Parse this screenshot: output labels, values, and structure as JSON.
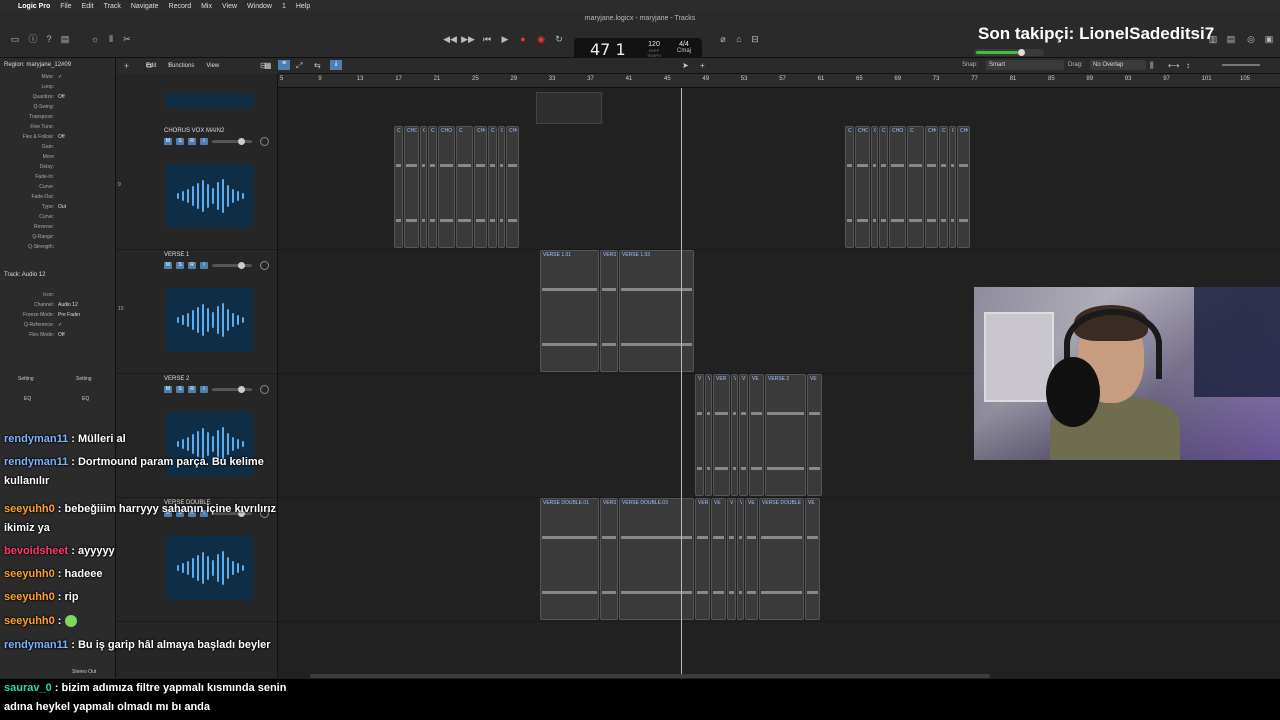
{
  "menubar": {
    "app": "Logic Pro",
    "items": [
      "File",
      "Edit",
      "Track",
      "Navigate",
      "Record",
      "Mix",
      "View",
      "Window",
      "1",
      "Help"
    ]
  },
  "window_title": "maryjane.logicx - maryjane - Tracks",
  "lcd": {
    "position": "47  1",
    "tempo": "120",
    "tempo_label": "KEEP",
    "tempo_sub": "TEMPO",
    "time_sig": "4/4",
    "key": "Cmaj",
    "key_label": "6/4"
  },
  "overlay": {
    "follower": "Son takipçi: LionelSadeditsi7"
  },
  "colors": {
    "accent": "#4f7fb0",
    "region_name": "#9ec5ff",
    "volume_green": "#3fc03f"
  },
  "toolbar": {
    "edit": "Edit",
    "functions": "Functions",
    "view": "View",
    "snap_label": "Snap:",
    "snap_value": "Smart",
    "drag_label": "Drag:",
    "drag_value": "No Overlap",
    "s_button": "S"
  },
  "inspector": {
    "region_header": "Region:  maryjane_12#09",
    "rows": [
      {
        "label": "Mute:",
        "value": "✓"
      },
      {
        "label": "Loop:",
        "value": ""
      },
      {
        "label": "Quantize:",
        "value": "Off"
      },
      {
        "label": "Q-Swing:",
        "value": ""
      },
      {
        "label": "Transpose:",
        "value": ""
      },
      {
        "label": "Fine Tune:",
        "value": ""
      },
      {
        "label": "Flex & Follow:",
        "value": "Off"
      },
      {
        "label": "Gain:",
        "value": ""
      },
      {
        "label": "More",
        "value": ""
      },
      {
        "label": "Delay:",
        "value": ""
      },
      {
        "label": "Fade-In:",
        "value": ""
      },
      {
        "label": "Curve:",
        "value": ""
      },
      {
        "label": "Fade-Out:",
        "value": ""
      },
      {
        "label": "Type:",
        "value": "Out"
      },
      {
        "label": "Curve:",
        "value": ""
      },
      {
        "label": "Reverse:",
        "value": ""
      },
      {
        "label": "Q-Range:",
        "value": ""
      },
      {
        "label": "Q-Strength:",
        "value": ""
      }
    ],
    "track_header": "Track:  Audio 12",
    "track_rows": [
      {
        "label": "Icon:",
        "value": ""
      },
      {
        "label": "Channel:",
        "value": "Audio 12"
      },
      {
        "label": "Freeze Mode:",
        "value": "Pre Fader"
      },
      {
        "label": "Q-Reference:",
        "value": "✓"
      },
      {
        "label": "Flex Mode:",
        "value": "Off"
      }
    ],
    "setting1": "Setting",
    "setting2": "Setting",
    "eq1": "EQ",
    "eq2": "EQ",
    "stereo_out": "Stereo Out"
  },
  "tracks": [
    {
      "num": "9",
      "name": "CHORUS VOX MAIN2"
    },
    {
      "num": "10",
      "name": "VERSE 1"
    },
    {
      "num": "",
      "name": "VERSE 2"
    },
    {
      "num": "",
      "name": "VERSE DOUBLE"
    }
  ],
  "ruler": [
    "5",
    "9",
    "13",
    "17",
    "21",
    "25",
    "29",
    "33",
    "37",
    "41",
    "45",
    "49",
    "53",
    "57",
    "61",
    "65",
    "69",
    "73",
    "77",
    "81",
    "85",
    "89",
    "93",
    "97",
    "101",
    "105"
  ],
  "regions": {
    "chorus": [
      "C",
      "CHO",
      "C",
      "C",
      "CHO",
      "C",
      "CHO",
      "C",
      "C",
      "CHO"
    ],
    "chorus2": [
      "C",
      "CHO",
      "C",
      "C",
      "CHO",
      "C",
      "CHO",
      "C",
      "C",
      "CHO"
    ],
    "verse1": [
      "VERSE 1.01",
      "VERS",
      "VERSE 1.03"
    ],
    "verse2": [
      "V",
      "V",
      "VER",
      "V",
      "V",
      "VE",
      "VERSE 2",
      "VE"
    ],
    "verse_double": [
      "VERSE DOUBLE.01",
      "VERS",
      "VERSE DOUBLE.03",
      "VER",
      "VE",
      "V",
      "V",
      "VE",
      "VERSE DOUBLE",
      "VE"
    ]
  },
  "chat": [
    {
      "user": "rendyman11",
      "text": "Mülleri al",
      "color": "#7fb3ff"
    },
    {
      "user": "rendyman11",
      "text": "Dortmound param parça. Bu kelime kullanılır",
      "color": "#7fb3ff"
    },
    {
      "user": "seeyuhh0",
      "text": "bebeğiiim harryyy sahanın içine kıvrılırız ikimiz ya",
      "color": "#ff9f2e"
    },
    {
      "user": "bevoidsheet",
      "text": "ayyyyy",
      "color": "#ff3b6b"
    },
    {
      "user": "seeyuhh0",
      "text": "hadeee",
      "color": "#ff9f2e"
    },
    {
      "user": "seeyuhh0",
      "text": "rip",
      "color": "#ff9f2e"
    },
    {
      "user": "seeyuhh0",
      "text": "",
      "color": "#ff9f2e"
    },
    {
      "user": "rendyman11",
      "text": "Bu iş garip hâl almaya başladı beyler",
      "color": "#7fb3ff"
    }
  ],
  "bottom_chat": {
    "user": "saurav_0",
    "text": "bizim adımıza filtre yapmalı kısmında senin adına heykel yapmalı olmadı mı bı anda",
    "color": "#2fd6b0"
  }
}
